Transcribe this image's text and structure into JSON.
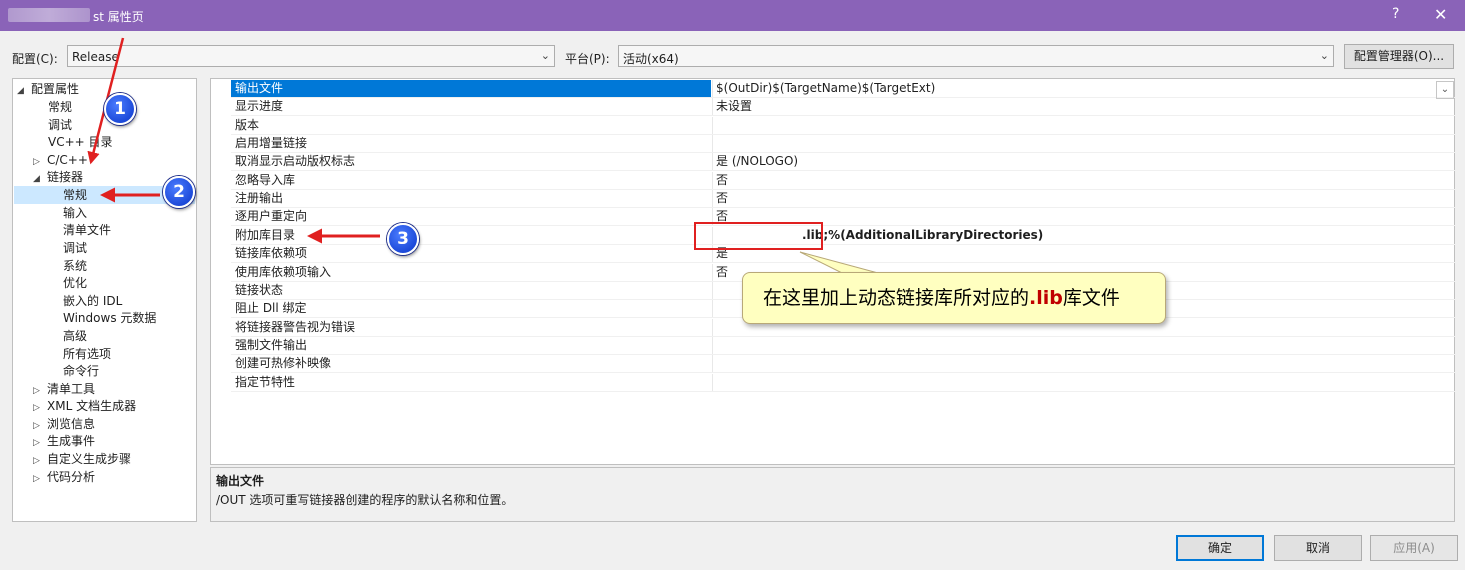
{
  "window": {
    "title": "st 属性页",
    "help": "?",
    "close": "✕"
  },
  "config": {
    "config_label": "配置(C):",
    "config_value": "Release",
    "platform_label": "平台(P):",
    "platform_value": "活动(x64)",
    "manager_button": "配置管理器(O)..."
  },
  "tree": {
    "items": [
      {
        "label": "配置属性",
        "glyph": "◢"
      },
      {
        "label": "常规"
      },
      {
        "label": "调试"
      },
      {
        "label": "VC++ 目录"
      },
      {
        "label": "C/C++",
        "glyph": "▷"
      },
      {
        "label": "链接器",
        "glyph": "◢"
      },
      {
        "label": "常规",
        "selected": true
      },
      {
        "label": "输入"
      },
      {
        "label": "清单文件"
      },
      {
        "label": "调试"
      },
      {
        "label": "系统"
      },
      {
        "label": "优化"
      },
      {
        "label": "嵌入的 IDL"
      },
      {
        "label": "Windows 元数据"
      },
      {
        "label": "高级"
      },
      {
        "label": "所有选项"
      },
      {
        "label": "命令行"
      },
      {
        "label": "清单工具",
        "glyph": "▷"
      },
      {
        "label": "XML 文档生成器",
        "glyph": "▷"
      },
      {
        "label": "浏览信息",
        "glyph": "▷"
      },
      {
        "label": "生成事件",
        "glyph": "▷"
      },
      {
        "label": "自定义生成步骤",
        "glyph": "▷"
      },
      {
        "label": "代码分析",
        "glyph": "▷"
      }
    ]
  },
  "grid": {
    "rows": [
      {
        "name": "输出文件",
        "value": "$(OutDir)$(TargetName)$(TargetExt)"
      },
      {
        "name": "显示进度",
        "value": "未设置"
      },
      {
        "name": "版本",
        "value": ""
      },
      {
        "name": "启用增量链接",
        "value": ""
      },
      {
        "name": "取消显示启动版权标志",
        "value": "是 (/NOLOGO)"
      },
      {
        "name": "忽略导入库",
        "value": "否"
      },
      {
        "name": "注册输出",
        "value": "否"
      },
      {
        "name": "逐用户重定向",
        "value": "否"
      },
      {
        "name": "附加库目录",
        "value": ".lib;%(AdditionalLibraryDirectories)"
      },
      {
        "name": "链接库依赖项",
        "value": "是"
      },
      {
        "name": "使用库依赖项输入",
        "value": "否"
      },
      {
        "name": "链接状态",
        "value": ""
      },
      {
        "name": "阻止 Dll 绑定",
        "value": ""
      },
      {
        "name": "将链接器警告视为错误",
        "value": ""
      },
      {
        "name": "强制文件输出",
        "value": ""
      },
      {
        "name": "创建可热修补映像",
        "value": ""
      },
      {
        "name": "指定节特性",
        "value": ""
      }
    ],
    "dropdown_glyph": "⌄"
  },
  "description": {
    "title": "输出文件",
    "text": "/OUT 选项可重写链接器创建的程序的默认名称和位置。"
  },
  "buttons": {
    "ok": "确定",
    "cancel": "取消",
    "apply": "应用(A)"
  },
  "annotations": {
    "badge1": "1",
    "badge2": "2",
    "badge3": "3",
    "callout_before": "在这里加上动态链接库所对应的",
    "callout_highlight": ".lib",
    "callout_after": "库文件"
  },
  "colors": {
    "titlebar": "#8a63b8",
    "selection": "#0078d7",
    "annotation_red": "#e02020",
    "badge_blue": "#1e4fe0",
    "callout_bg": "#ffffc0"
  }
}
